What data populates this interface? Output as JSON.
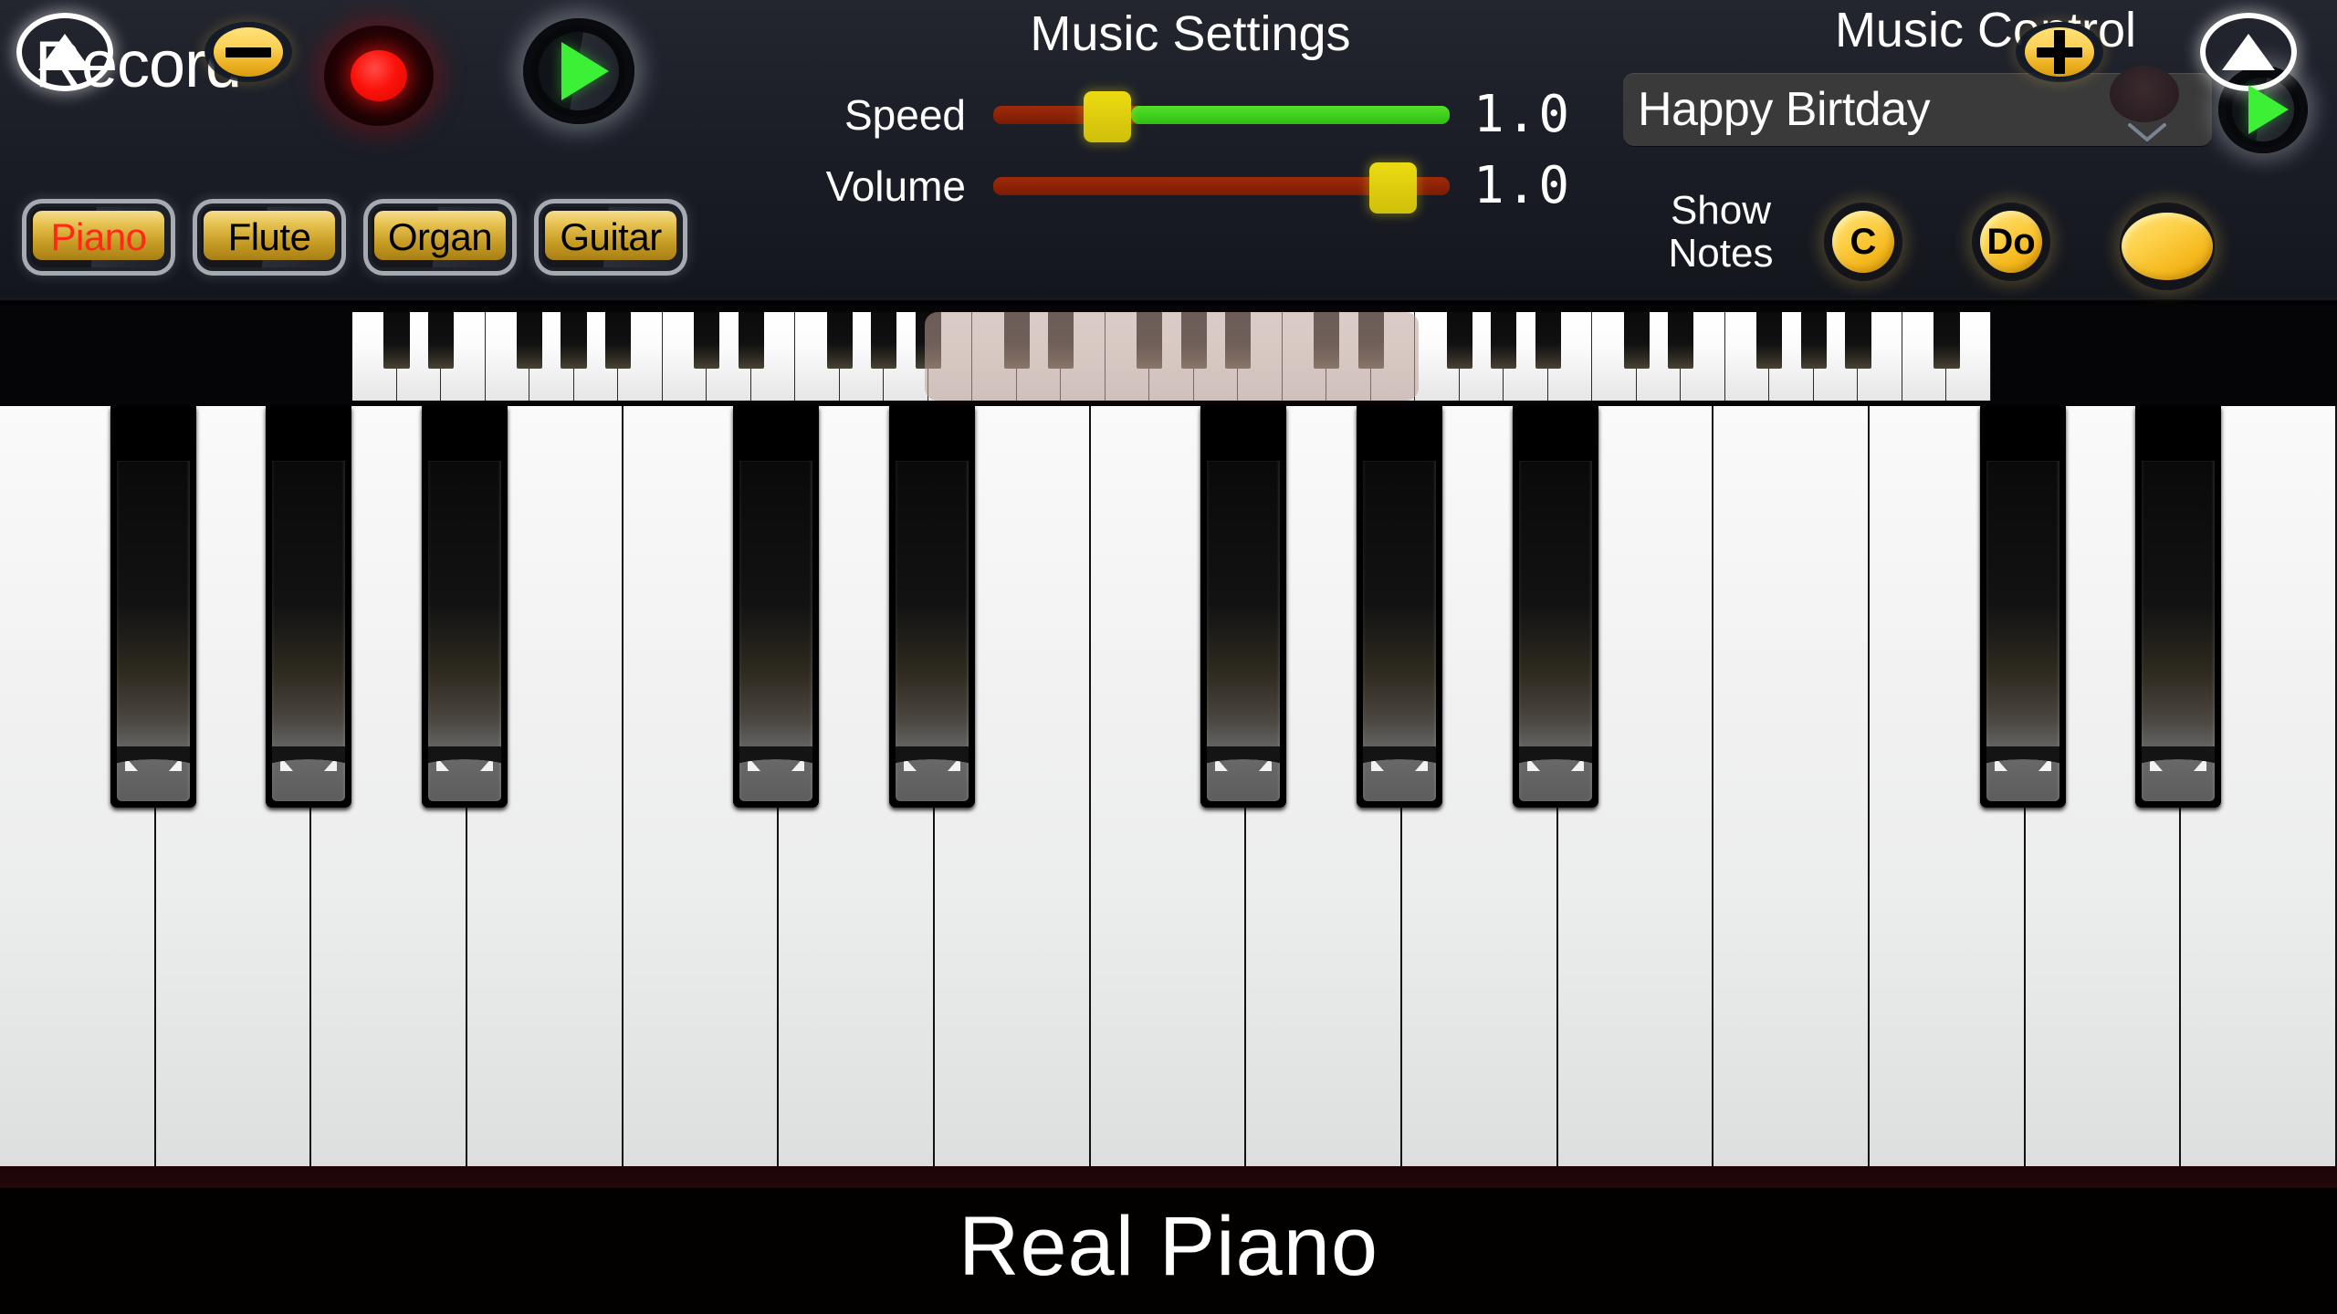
{
  "app": {
    "title": "Real Piano"
  },
  "record": {
    "label": "Record",
    "record_icon": "record-dot-icon",
    "play_icon": "play-triangle-icon"
  },
  "instruments": {
    "selected": "Piano",
    "items": [
      {
        "label": "Piano",
        "selected": true
      },
      {
        "label": "Flute",
        "selected": false
      },
      {
        "label": "Organ",
        "selected": false
      },
      {
        "label": "Guitar",
        "selected": false
      }
    ]
  },
  "music_settings": {
    "title": "Music Settings",
    "speed": {
      "label": "Speed",
      "value": "1.0",
      "percent": 22
    },
    "volume": {
      "label": "Volume",
      "value": "1.0",
      "percent": 92
    }
  },
  "music_control": {
    "title": "Music Control",
    "selected_song": "Happy Birtday",
    "dropdown_icon": "chevron-down-icon",
    "play_icon": "play-triangle-icon",
    "show_notes_label": "Show Notes",
    "note_buttons": [
      {
        "label": "C",
        "name": "note-letter-button"
      },
      {
        "label": "Do",
        "name": "note-solfege-button"
      },
      {
        "label": "",
        "name": "note-off-button"
      }
    ]
  },
  "nav": {
    "octave_up_left_icon": "triangle-up-circle-icon",
    "octave_up_right_icon": "triangle-up-circle-icon",
    "zoom_out_icon": "minus-icon",
    "zoom_in_icon": "plus-icon"
  },
  "mini_keyboard": {
    "white_key_count": 37,
    "selection": {
      "start_white_index": 13,
      "white_keys_visible": 11
    }
  },
  "keyboard": {
    "white_key_count": 15,
    "black_key_pattern": [
      1,
      1,
      1,
      0,
      1,
      1,
      0,
      1,
      1,
      1,
      0,
      0,
      1,
      1,
      0
    ]
  },
  "colors": {
    "panel_bg": "#1b1e27",
    "accent_yellow": "#fbd054",
    "accent_green": "#3cf135",
    "accent_red": "#ff2a16",
    "slider_track": "#9e2a0a",
    "slider_fill": "#53e02c",
    "selection_overlay": "#bea098"
  }
}
